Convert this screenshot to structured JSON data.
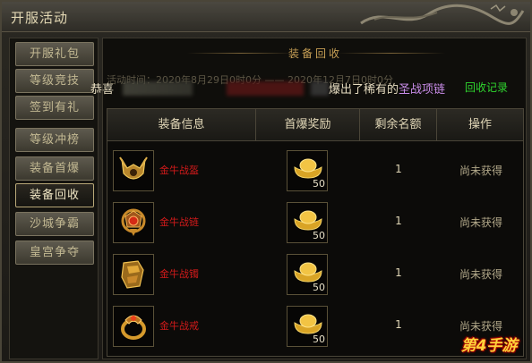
{
  "window": {
    "title": "开服活动"
  },
  "sidebar": {
    "items": [
      {
        "label": "开服礼包",
        "active": false
      },
      {
        "label": "等级竞技",
        "active": false
      },
      {
        "label": "签到有礼",
        "active": false
      },
      {
        "label": "等级冲榜",
        "active": false
      },
      {
        "label": "装备首爆",
        "active": false
      },
      {
        "label": "装备回收",
        "active": true
      },
      {
        "label": "沙城争霸",
        "active": false
      },
      {
        "label": "皇宫争夺",
        "active": false
      }
    ]
  },
  "panel": {
    "title": "装备回收",
    "time": "活动时间：2020年8月29日0时0分 —— 2020年12月7日0时0分",
    "broadcast": {
      "prefix": "恭喜",
      "middle": "爆出了稀有的",
      "item": "圣战项链"
    },
    "record_link": "回收记录"
  },
  "table": {
    "headers": [
      "装备信息",
      "首爆奖励",
      "剩余名额",
      "操作"
    ],
    "rows": [
      {
        "name": "金牛战盔",
        "icon": "helmet-icon",
        "reward_icon": "gold-ingot-icon",
        "reward_count": "50",
        "remaining": "1",
        "status": "尚未获得"
      },
      {
        "name": "金牛战链",
        "icon": "necklace-icon",
        "reward_icon": "gold-ingot-icon",
        "reward_count": "50",
        "remaining": "1",
        "status": "尚未获得"
      },
      {
        "name": "金牛战镯",
        "icon": "bracelet-icon",
        "reward_icon": "gold-ingot-icon",
        "reward_count": "50",
        "remaining": "1",
        "status": "尚未获得"
      },
      {
        "name": "金牛战戒",
        "icon": "ring-icon",
        "reward_icon": "gold-ingot-icon",
        "reward_count": "50",
        "remaining": "1",
        "status": "尚未获得"
      }
    ]
  },
  "watermark": {
    "text": "第4手游"
  },
  "colors": {
    "item_name": "#d11a1a",
    "record_link": "#2fd62f",
    "rare_item": "#c88ce8",
    "panel_title": "#c79f55"
  }
}
